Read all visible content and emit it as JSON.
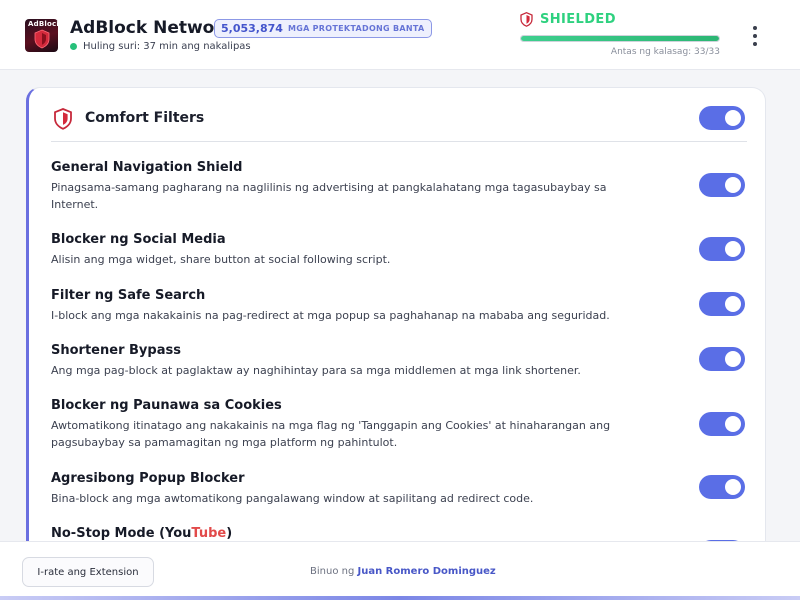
{
  "header": {
    "logo_text": "AdBlock",
    "title": "AdBlock Network",
    "blocked_count": "5,053,874",
    "blocked_label": "MGA PROTEKTADONG BANTA",
    "last_check": "Huling suri: 37 min ang nakalipas",
    "shield_status": "SHIELDED",
    "layers_label": "Antas ng kalasag: 33/33",
    "layers_fraction": 1.0
  },
  "section": {
    "title": "Comfort Filters",
    "enabled": true
  },
  "filters": [
    {
      "name": "General Navigation Shield",
      "description": "Pinagsama-samang pagharang na naglilinis ng advertising at pangkalahatang mga tagasubaybay sa Internet.",
      "enabled": true
    },
    {
      "name": "Blocker ng Social Media",
      "description": "Alisin ang mga widget, share button at social following script.",
      "enabled": true
    },
    {
      "name": "Filter ng Safe Search",
      "description": "I-block ang mga nakakainis na pag-redirect at mga popup sa paghahanap na mababa ang seguridad.",
      "enabled": true
    },
    {
      "name": "Shortener Bypass",
      "description": "Ang mga pag-block at paglaktaw ay naghihintay para sa mga middlemen at mga link shortener.",
      "enabled": true
    },
    {
      "name": "Blocker ng Paunawa sa Cookies",
      "description": "Awtomatikong itinatago ang nakakainis na mga flag ng 'Tanggapin ang Cookies' at hinaharangan ang pagsubaybay sa pamamagitan ng mga platform ng pahintulot.",
      "enabled": true
    },
    {
      "name": "Agresibong Popup Blocker",
      "description": "Bina-block ang mga awtomatikong pangalawang window at sapilitang ad redirect code.",
      "enabled": true
    },
    {
      "name_prefix": "No-Stop Mode (",
      "name_you": "You",
      "name_tube": "Tube",
      "name_suffix": ")",
      "enabled": true
    }
  ],
  "footer": {
    "rate_label": "I-rate ang Extension",
    "built_by_prefix": "Binuo ng",
    "author": "Juan Romero Dominguez"
  },
  "colors": {
    "accent": "#5a6ee6",
    "shield_green": "#2ed17f",
    "youtube_red": "#e24a4a",
    "author_blue": "#4857c7"
  }
}
